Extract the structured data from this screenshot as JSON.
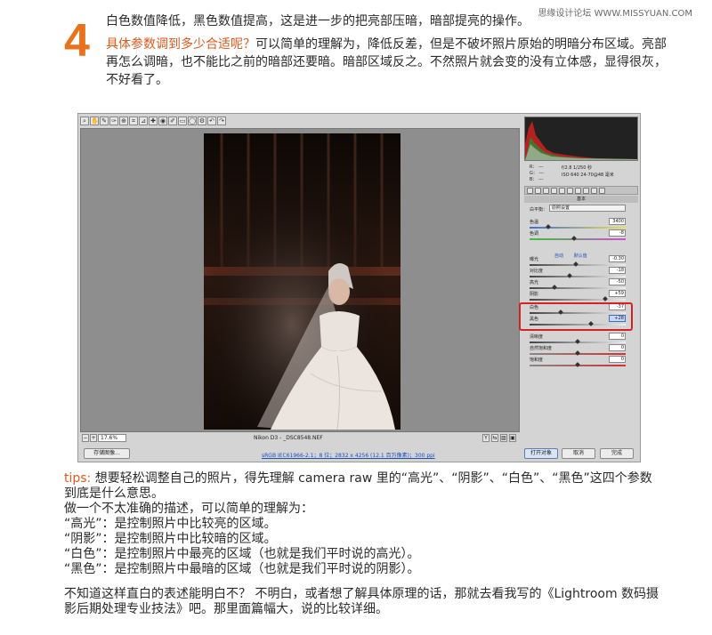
{
  "watermark": "思缘设计论坛 WWW.MISSYUAN.COM",
  "step": {
    "number": "4",
    "line1": "白色数值降低，黑色数值提高，这是进一步的把亮部压暗，暗部提亮的操作。",
    "question": "具体参数调到多少合适呢？",
    "answer": "可以简单的理解为，降低反差，但是不破坏照片原始的明暗分布区域。亮部再怎么调暗，也不能比之前的暗部还要暗。暗部区域反之。不然照片就会变的没有立体感，显得很灰，不好看了。"
  },
  "camera_raw": {
    "toolbar_icons": [
      "zoom-icon",
      "hand-icon",
      "white-balance-icon",
      "color-sampler-icon",
      "target-adjust-icon",
      "crop-icon",
      "straighten-icon",
      "spot-removal-icon",
      "red-eye-icon",
      "adjust-brush-icon",
      "graduated-filter-icon",
      "radial-filter-icon",
      "preferences-icon",
      "rotate-ccw-icon",
      "rotate-cw-icon"
    ],
    "toolbar_glyphs": [
      "⌕",
      "✋",
      "✎",
      "✑",
      "⊕",
      "⌗",
      "⊿",
      "✚",
      "◉",
      "✐",
      "▭",
      "◯",
      "⚙",
      "↶",
      "↷"
    ],
    "zoom": "17.6%",
    "filename": "Nikon D3 - _DSC8548.NEF",
    "workflow_link": "sRGB IEC61966-2.1；8 位；2832 x 4256 (12.1 百万像素)；300 ppi",
    "save_button": "存储图像...",
    "open_button": "打开对象",
    "cancel_button": "取消",
    "done_button": "完成",
    "readout": {
      "r": "R： ---",
      "g": "G： ---",
      "b": "B： ---",
      "camera_line1": "f/2.8   1/250 秒",
      "camera_line2": "ISO 640   24-70@48 毫米"
    },
    "section_title": "基本",
    "wb_label": "白平衡：",
    "wb_value": "原照设置",
    "auto_label": "自动",
    "default_label": "默认值",
    "controls": [
      {
        "label": "色温",
        "value": "3400",
        "pos": 0.18
      },
      {
        "label": "色调",
        "value": "-8",
        "pos": 0.46
      },
      {
        "label": "曝光",
        "value": "-0.30",
        "pos": 0.48
      },
      {
        "label": "对比度",
        "value": "-18",
        "pos": 0.41
      },
      {
        "label": "高光",
        "value": "-50",
        "pos": 0.25
      },
      {
        "label": "阴影",
        "value": "+59",
        "pos": 0.8
      },
      {
        "label": "白色",
        "value": "-37",
        "pos": 0.32
      },
      {
        "label": "黑色",
        "value": "+28",
        "pos": 0.64
      },
      {
        "label": "清晰度",
        "value": "0",
        "pos": 0.5
      },
      {
        "label": "自然饱和度",
        "value": "0",
        "pos": 0.5
      },
      {
        "label": "饱和度",
        "value": "0",
        "pos": 0.5
      }
    ],
    "colors": {
      "accent_orange": "#e8731c",
      "highlight_red": "#d22222",
      "link_blue": "#1d4fb8"
    }
  },
  "tips": {
    "label": "tips:",
    "line1": "想要轻松调整自己的照片，得先理解 camera raw 里的“高光”、“阴影”、“白色”、“黑色”这四个参数到底是什么意思。",
    "line2": "做一个不太准确的描述，可以简单的理解为：",
    "items": [
      "“高光”：是控制照片中比较亮的区域。",
      "“阴影”：是控制照片中比较暗的区域。",
      "“白色”：是控制照片中最亮的区域（也就是我们平时说的高光）。",
      "“黑色”：是控制照片中最暗的区域（也就是我们平时说的阴影）。"
    ],
    "closing": "不知道这样直白的表述能明白不？ 不明白，或者想了解具体原理的话，那就去看我写的《Lightroom 数码摄影后期处理专业技法》吧。那里面篇幅大，说的比较详细。"
  }
}
